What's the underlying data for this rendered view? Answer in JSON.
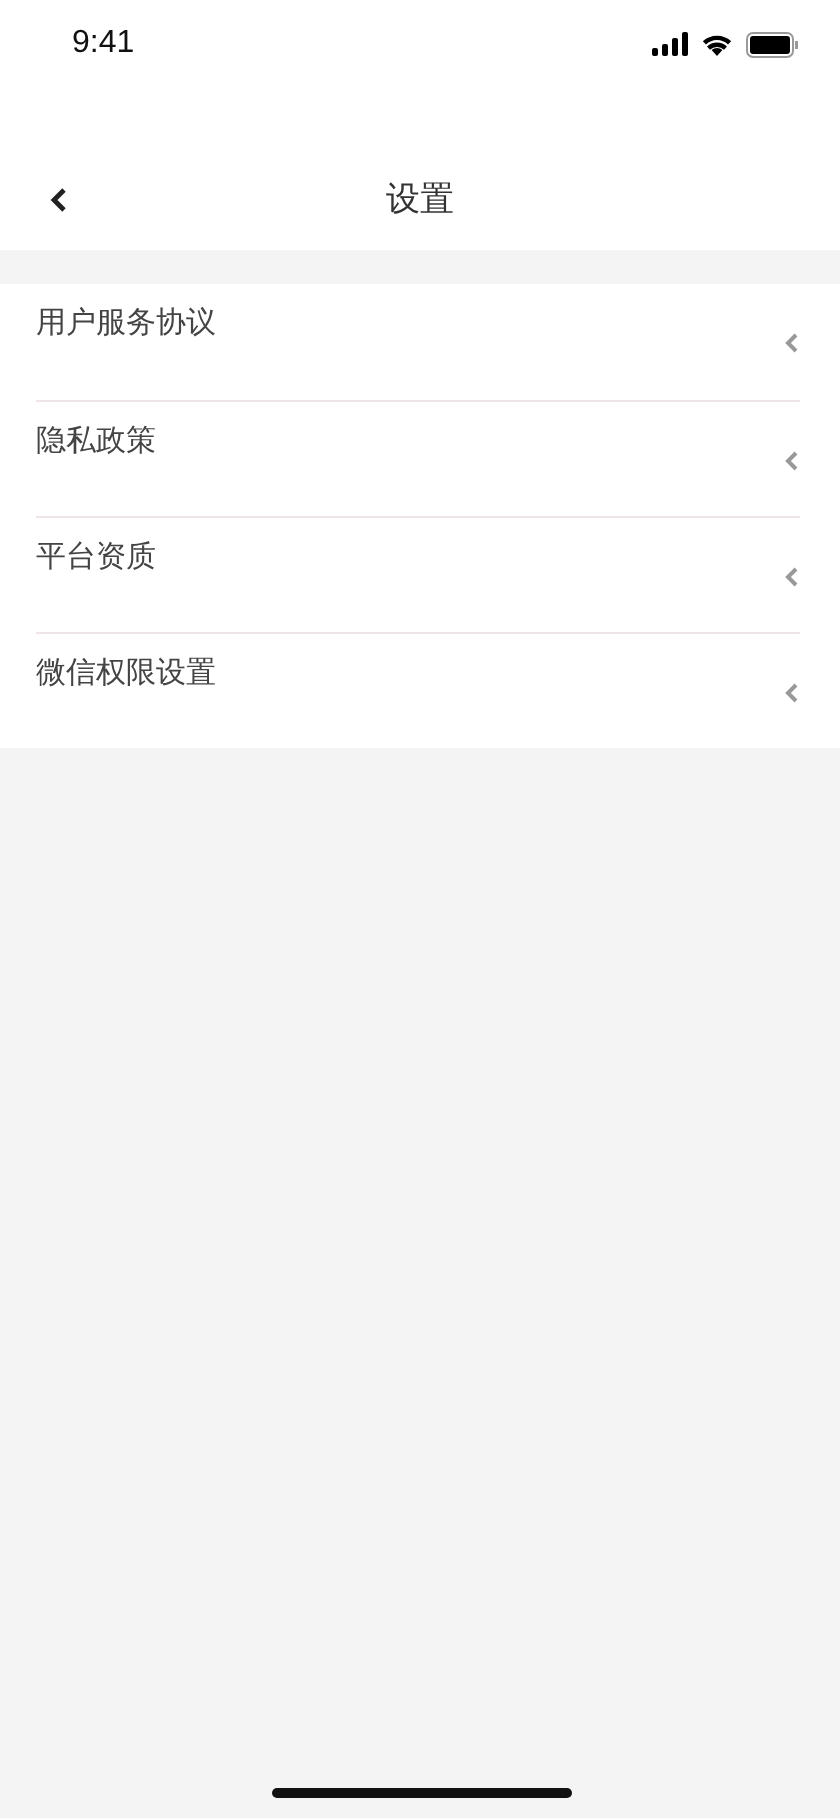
{
  "status_bar": {
    "time": "9:41"
  },
  "nav_bar": {
    "title": "设置"
  },
  "menu": [
    {
      "label": "用户服务协议"
    },
    {
      "label": "隐私政策"
    },
    {
      "label": "平台资质"
    },
    {
      "label": "微信权限设置"
    }
  ]
}
